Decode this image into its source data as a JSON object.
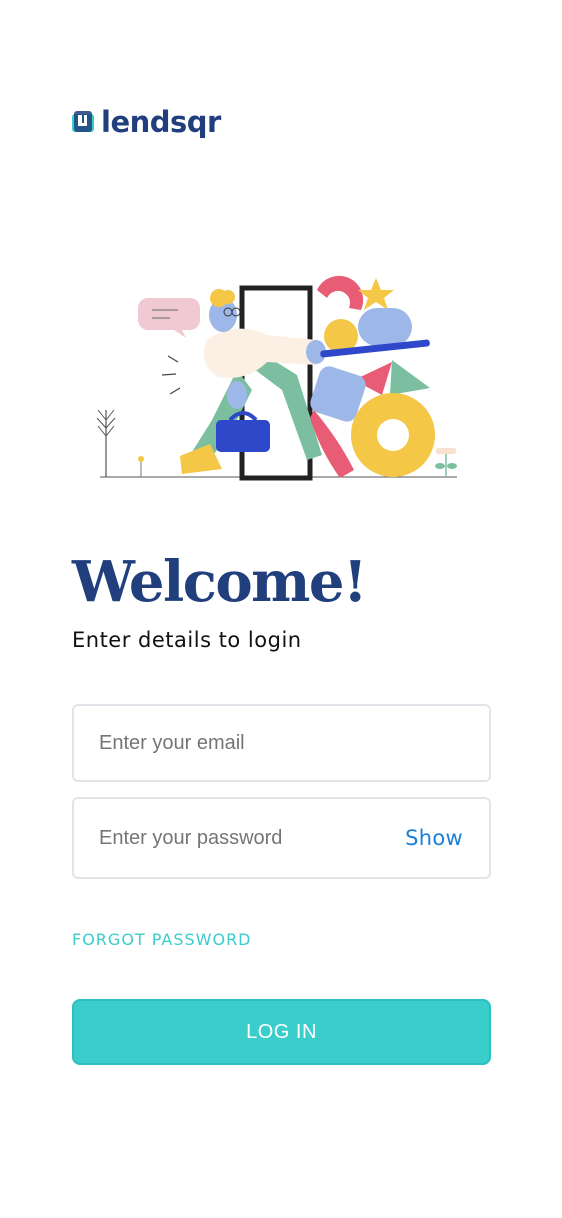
{
  "brand": {
    "name": "lendsqr",
    "logo_icon": "lendsqr-logo-icon",
    "primary_color": "#213F7D",
    "accent_color": "#39CDCC"
  },
  "hero": {
    "illustration": "person-carrying-bag-through-door-illustration"
  },
  "heading": {
    "title": "Welcome!",
    "subtitle": "Enter details to login"
  },
  "form": {
    "email_placeholder": "Enter your email",
    "email_value": "",
    "password_placeholder": "Enter your password",
    "password_value": "",
    "show_label": "Show",
    "forgot_label": "FORGOT PASSWORD",
    "login_label": "LOG IN"
  }
}
